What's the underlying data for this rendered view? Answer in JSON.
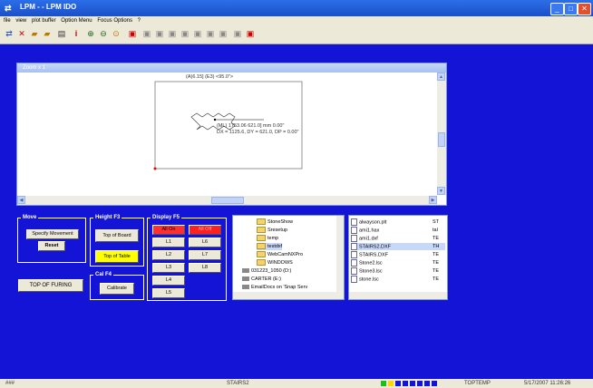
{
  "app": {
    "title": "LPM - - LPM IDO"
  },
  "menu": [
    "file",
    "view",
    "plot buffer",
    "Option Menu",
    "Focus Options",
    "?"
  ],
  "zoom": {
    "title": "Zoom x 1",
    "dim_top": "(A)6.15] (E3) <95.0\">",
    "dim_line1": "(ML) 1753.06 621.0] mm 0.00\"",
    "dim_line2": "DX = 1125.6, DY = 621.0, DP = 0.00\""
  },
  "move": {
    "label": "Move",
    "specify": "Specify Movement",
    "reset": "Reset"
  },
  "height": {
    "label": "Height F3",
    "top_board": "Top of Board",
    "top_table": "Top of Table"
  },
  "cal": {
    "label": "Cal F4",
    "calibrate": "Calibrate"
  },
  "display": {
    "label": "Display F5",
    "buttons": [
      "All On",
      "All Off",
      "L1",
      "L6",
      "L2",
      "L7",
      "L3",
      "L8",
      "L4",
      "L5"
    ]
  },
  "top_furring": "TOP OF FURING",
  "tree": {
    "items": [
      {
        "label": "StoneShow",
        "type": "folder"
      },
      {
        "label": "Sresetup",
        "type": "folder"
      },
      {
        "label": "temp",
        "type": "folder"
      },
      {
        "label": "testdxf",
        "type": "folder"
      },
      {
        "label": "WebCamNXPro",
        "type": "folder"
      },
      {
        "label": "WINDOWS",
        "type": "folder"
      },
      {
        "label": "031223_1050 (D:)",
        "type": "drive"
      },
      {
        "label": "CARTER (E:)",
        "type": "drive"
      },
      {
        "label": "EmailDocs on 'Snap Serv",
        "type": "drive"
      }
    ]
  },
  "files": {
    "items": [
      {
        "name": "alwayson.plt",
        "ext": "ST"
      },
      {
        "name": "ami1.hax",
        "ext": "tal"
      },
      {
        "name": "ami1.dxf",
        "ext": "TE"
      },
      {
        "name": "STAIRS2.DXF",
        "ext": "TH"
      },
      {
        "name": "STAIRS.DXF",
        "ext": "TE"
      },
      {
        "name": "Stone2.lsc",
        "ext": "TE"
      },
      {
        "name": "Stone3.lsc",
        "ext": "TE"
      },
      {
        "name": "stone.lsc",
        "ext": "TE"
      }
    ]
  },
  "status": {
    "left": "###",
    "file": "STAIRS2",
    "mid": "TOPTEMP",
    "datetime": "5/17/2007 11:26:26"
  }
}
